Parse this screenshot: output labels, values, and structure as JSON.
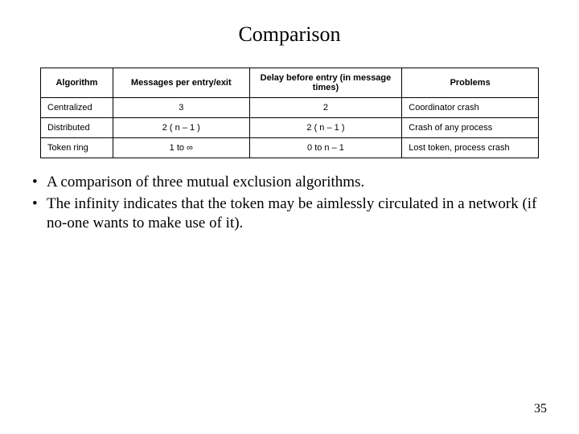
{
  "title": "Comparison",
  "table": {
    "headers": [
      "Algorithm",
      "Messages per entry/exit",
      "Delay before entry (in message times)",
      "Problems"
    ],
    "rows": [
      {
        "algo": "Centralized",
        "msg": "3",
        "delay": "2",
        "prob": "Coordinator crash"
      },
      {
        "algo": "Distributed",
        "msg": "2 ( n – 1 )",
        "delay": "2 ( n – 1 )",
        "prob": "Crash of any process"
      },
      {
        "algo": "Token ring",
        "msg": "1 to ∞",
        "delay": "0 to n – 1",
        "prob": "Lost token, process crash"
      }
    ]
  },
  "bullets": [
    "A comparison of three mutual exclusion algorithms.",
    "The infinity indicates that the token may be aimlessly circulated in a network (if no-one wants to make use of it)."
  ],
  "page_number": "35"
}
